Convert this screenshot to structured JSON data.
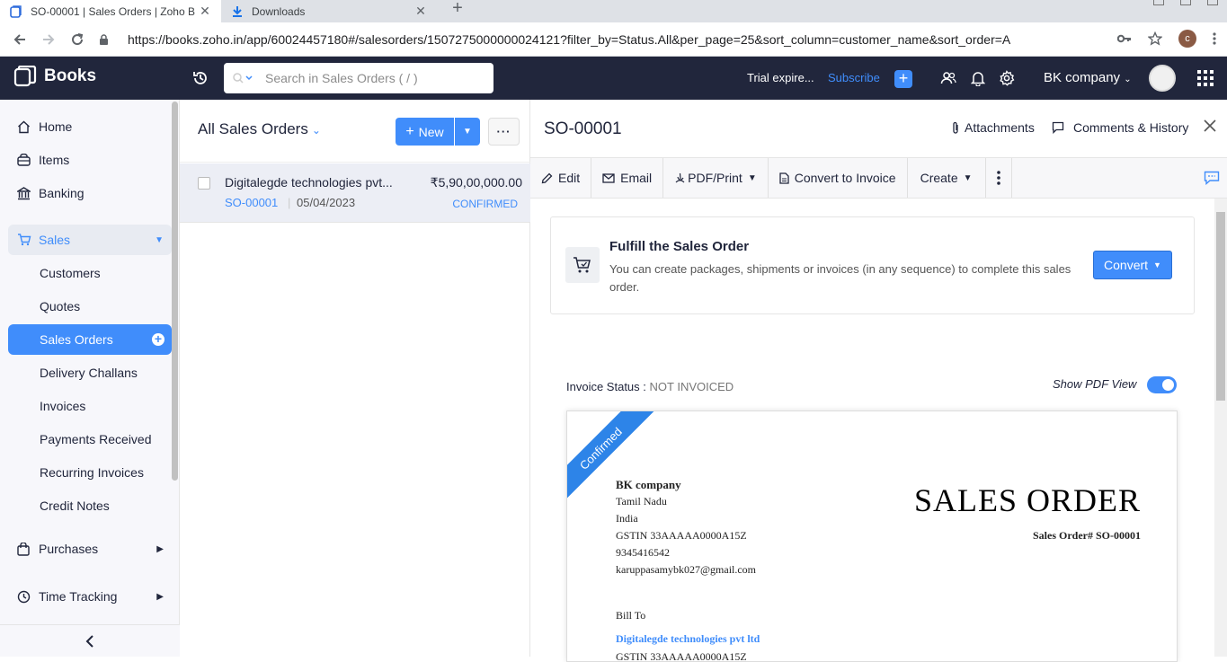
{
  "browser": {
    "tabs": [
      {
        "title": "SO-00001 | Sales Orders | Zoho B",
        "icon": "zoho-books-icon"
      },
      {
        "title": "Downloads",
        "icon": "download-icon"
      }
    ],
    "url": "https://books.zoho.in/app/60024457180#/salesorders/1507275000000024121?filter_by=Status.All&per_page=25&sort_column=customer_name&sort_order=A",
    "profile_initial": "c"
  },
  "header": {
    "app_name": "Books",
    "search_placeholder": "Search in Sales Orders ( / )",
    "trial_text": "Trial expire...",
    "subscribe_label": "Subscribe",
    "org_name": "BK company"
  },
  "sidebar": {
    "items": [
      {
        "label": "Home"
      },
      {
        "label": "Items"
      },
      {
        "label": "Banking"
      },
      {
        "label": "Sales"
      },
      {
        "label": "Customers"
      },
      {
        "label": "Quotes"
      },
      {
        "label": "Sales Orders"
      },
      {
        "label": "Delivery Challans"
      },
      {
        "label": "Invoices"
      },
      {
        "label": "Payments Received"
      },
      {
        "label": "Recurring Invoices"
      },
      {
        "label": "Credit Notes"
      },
      {
        "label": "Purchases"
      },
      {
        "label": "Time Tracking"
      }
    ]
  },
  "list": {
    "title": "All Sales Orders",
    "new_label": "New",
    "rows": [
      {
        "customer": "Digitalegde technologies pvt...",
        "amount": "₹5,90,00,000.00",
        "so_number": "SO-00001",
        "date": "05/04/2023",
        "status": "CONFIRMED"
      }
    ]
  },
  "detail": {
    "title": "SO-00001",
    "attachments_label": "Attachments",
    "comments_label": "Comments & History",
    "toolbar": {
      "edit": "Edit",
      "email": "Email",
      "pdf_print": "PDF/Print",
      "convert_invoice": "Convert to Invoice",
      "create": "Create"
    },
    "fulfill": {
      "heading": "Fulfill the Sales Order",
      "description": "You can create packages, shipments or invoices (in any sequence) to complete this sales order.",
      "convert_label": "Convert"
    },
    "invoice_status_label": "Invoice Status :",
    "invoice_status_value": "NOT INVOICED",
    "show_pdf_label": "Show PDF View",
    "show_pdf_enabled": true
  },
  "document": {
    "ribbon": "Confirmed",
    "org_name": "BK company",
    "org_lines": [
      "Tamil Nadu",
      "India",
      "GSTIN 33AAAAA0000A15Z",
      "9345416542",
      "karuppasamybk027@gmail.com"
    ],
    "doc_title": "SALES ORDER",
    "doc_number": "Sales Order# SO-00001",
    "bill_to_label": "Bill To",
    "bill_to_name": "Digitalegde technologies pvt ltd",
    "bill_to_gstin": "GSTIN 33AAAAA0000A15Z"
  },
  "colors": {
    "accent": "#408dfb",
    "header_bg": "#21263c",
    "sidebar_bg": "#f7f7fb"
  }
}
